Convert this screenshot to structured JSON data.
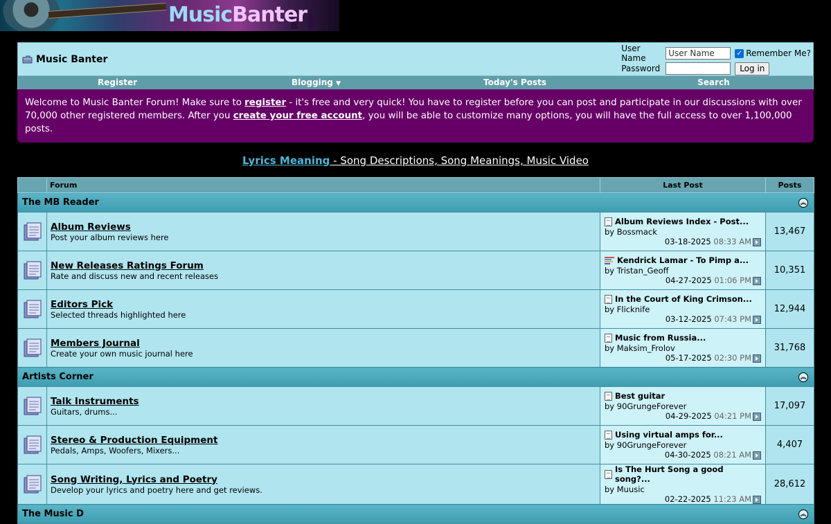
{
  "banner": {
    "logo_part1": "Music",
    "logo_part2": "Banter"
  },
  "header": {
    "site_title": "Music Banter",
    "login": {
      "username_label": "User Name",
      "username_value": "User Name",
      "password_label": "Password",
      "password_value": "",
      "remember_label": "Remember Me?",
      "remember_checked": true,
      "login_button": "Log in"
    }
  },
  "nav": {
    "register": "Register",
    "blogging": "Blogging",
    "todays_posts": "Today's Posts",
    "search": "Search"
  },
  "welcome": {
    "part1": "Welcome to Music Banter Forum! Make sure to ",
    "link1": "register",
    "part2": " - it's free and very quick! You have to register before you can post and participate in our discussions with over 70,000 other registered members. After you ",
    "link2": "create your free account",
    "part3": ", you will be able to customize many options, you will have the full access to over 1,100,000 posts."
  },
  "lyrics": {
    "link": "Lyrics Meaning",
    "desc": " - Song Descriptions, Song Meanings, Music Video"
  },
  "table": {
    "headers": {
      "forum": "Forum",
      "last_post": "Last Post",
      "posts": "Posts"
    },
    "categories": [
      {
        "name": "The MB Reader",
        "forums": [
          {
            "title": "Album Reviews",
            "desc": "Post your album reviews here",
            "lp_title": "Album Reviews Index - Post...",
            "lp_by": "by Bossmack",
            "lp_date": "03-18-2025",
            "lp_time": "08:33 AM",
            "lp_icon": "doc-icon",
            "posts": "13,467"
          },
          {
            "title": "New Releases Ratings Forum",
            "desc": "Rate and discuss new and recent releases",
            "lp_title": "Kendrick Lamar - To Pimp a...",
            "lp_by": "by Tristan_Geoff",
            "lp_date": "04-27-2025",
            "lp_time": "01:06 PM",
            "lp_icon": "bars-icon",
            "posts": "10,351"
          },
          {
            "title": "Editors Pick",
            "desc": "Selected threads highlighted here",
            "lp_title": "In the Court of King Crimson...",
            "lp_by": "by Flicknife",
            "lp_date": "03-12-2025",
            "lp_time": "07:43 PM",
            "lp_icon": "doc-icon",
            "posts": "12,944"
          },
          {
            "title": "Members Journal",
            "desc": "Create your own music journal here",
            "lp_title": "Music from Russia...",
            "lp_by": "by Maksim_Frolov",
            "lp_date": "05-17-2025",
            "lp_time": "02:30 PM",
            "lp_icon": "doc-icon",
            "posts": "31,768"
          }
        ]
      },
      {
        "name": "Artists Corner",
        "forums": [
          {
            "title": "Talk Instruments",
            "desc": "Guitars, drums...",
            "lp_title": "Best guitar",
            "lp_by": "by 90GrungeForever",
            "lp_date": "04-29-2025",
            "lp_time": "04:21 PM",
            "lp_icon": "doc-icon",
            "posts": "17,097"
          },
          {
            "title": "Stereo & Production Equipment",
            "desc": "Pedals, Amps, Woofers, Mixers...",
            "lp_title": "Using virtual amps for...",
            "lp_by": "by 90GrungeForever",
            "lp_date": "04-30-2025",
            "lp_time": "08:21 AM",
            "lp_icon": "doc-icon",
            "posts": "4,407"
          },
          {
            "title": "Song Writing, Lyrics and Poetry",
            "desc": "Develop your lyrics and poetry here and get reviews.",
            "lp_title": "Is The Hurt Song a good song?...",
            "lp_by": "by Muusic",
            "lp_date": "02-22-2025",
            "lp_time": "11:23 AM",
            "lp_icon": "doc-icon",
            "posts": "28,612"
          }
        ]
      },
      {
        "name": "The Music D",
        "forums": []
      }
    ]
  },
  "colors": {
    "background": "#000000",
    "header_bg": "#b0e5ef",
    "nav_bg": "#5f9ea8",
    "welcome_bg": "#660066",
    "category_bg": "#4aa8bb",
    "lastpost_bg": "#cdf2f8",
    "lyrics_link": "#4fb6d8"
  }
}
